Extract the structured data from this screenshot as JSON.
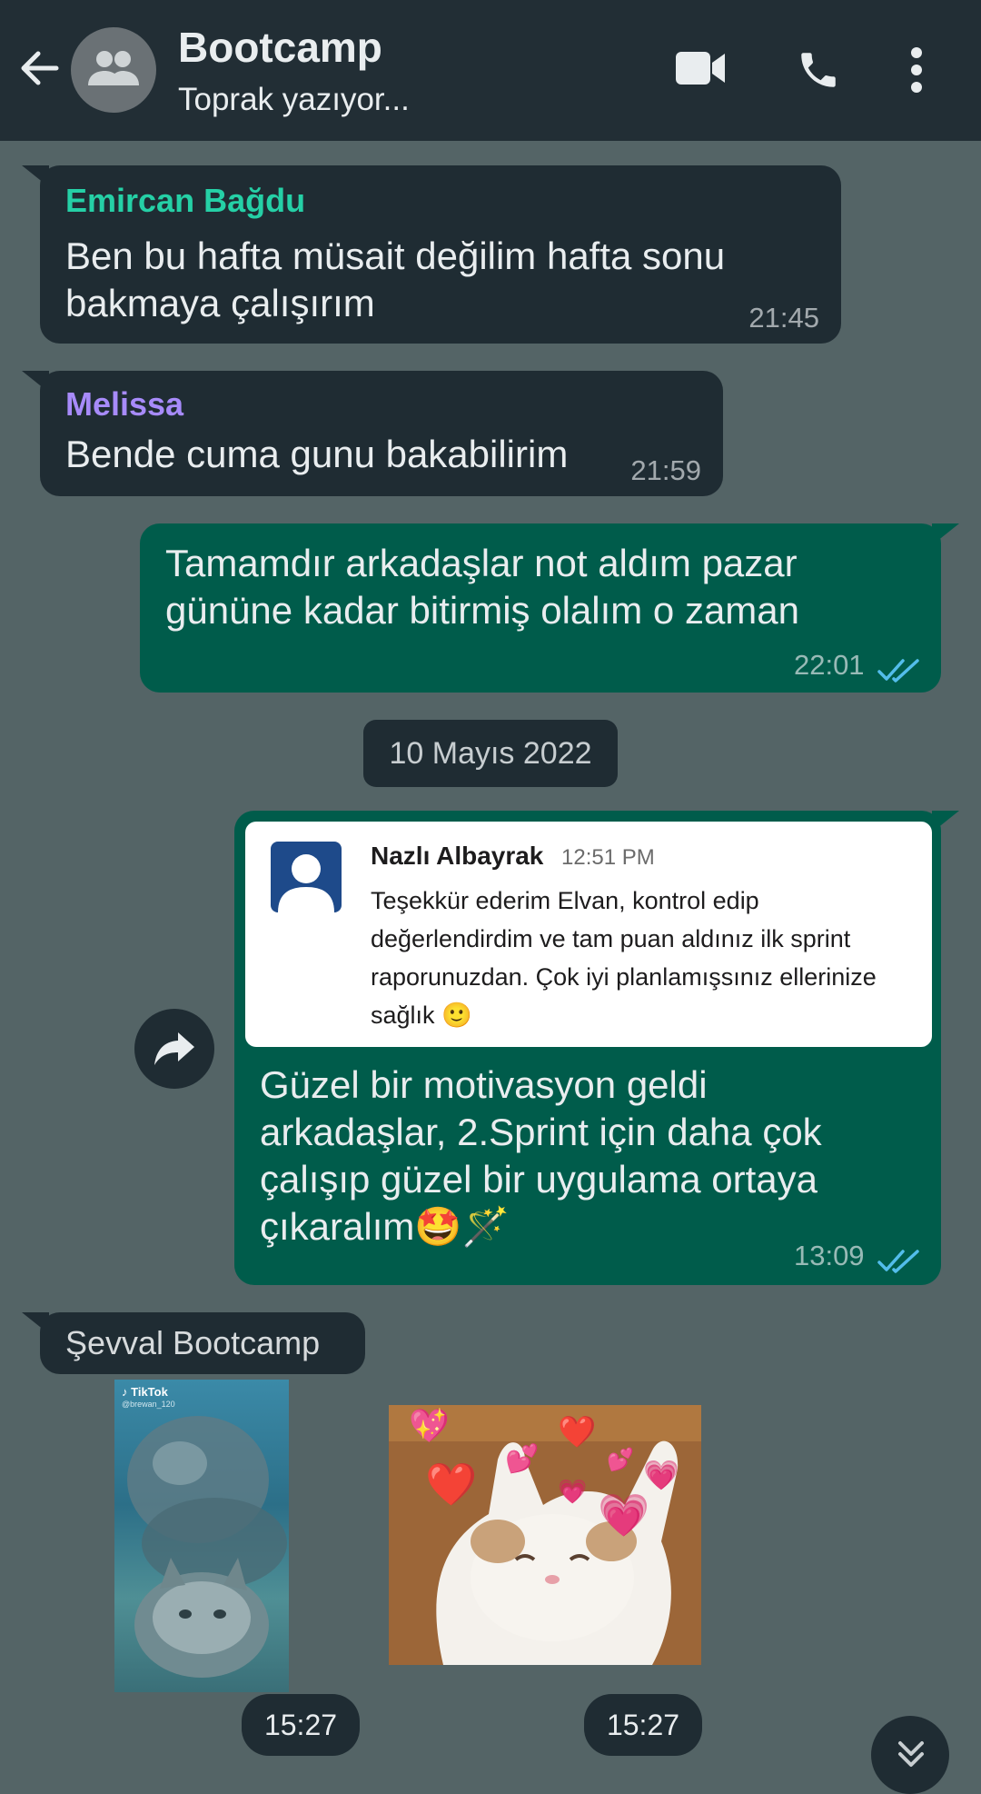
{
  "header": {
    "title": "Bootcamp",
    "subtitle": "Toprak yazıyor..."
  },
  "messages": [
    {
      "sender": "Emircan Bağdu",
      "sender_color": "#25d0a6",
      "line1": "Ben bu hafta müsait değilim hafta sonu",
      "line2": "bakmaya çalışırım",
      "time": "21:45"
    },
    {
      "sender": "Melissa",
      "sender_color": "#a78bfa",
      "line1": "Bende cuma gunu bakabilirim",
      "time": "21:59"
    },
    {
      "line1": "Tamamdır arkadaşlar not aldım pazar",
      "line2": "gününe kadar bitirmiş olalım o zaman",
      "time": "22:01"
    }
  ],
  "date_chip": "10 Mayıs 2022",
  "forwarded": {
    "card_name": "Nazlı Albayrak",
    "card_time": "12:51 PM",
    "card_text": "Teşekkür ederim Elvan, kontrol edip değerlendirdim ve tam puan aldınız ilk sprint raporunuzdan. Çok iyi planlamışsınız ellerinize sağlık 🙂",
    "line1": "Güzel bir motivasyon geldi",
    "line2": "arkadaşlar, 2.Sprint için daha çok",
    "line3": "çalışıp güzel bir uygulama ortaya",
    "line4": "çıkaralım🤩🪄",
    "time": "13:09"
  },
  "last_sender": "Şevval Bootcamp",
  "media": {
    "tiktok_label": "TikTok",
    "tiktok_user": "@brewan_120",
    "time1": "15:27",
    "time2": "15:27"
  },
  "colors": {
    "background": "#546466",
    "header": "#222e35",
    "incoming": "#1f2c33",
    "outgoing": "#005c4b",
    "read_ticks": "#53bdeb"
  }
}
